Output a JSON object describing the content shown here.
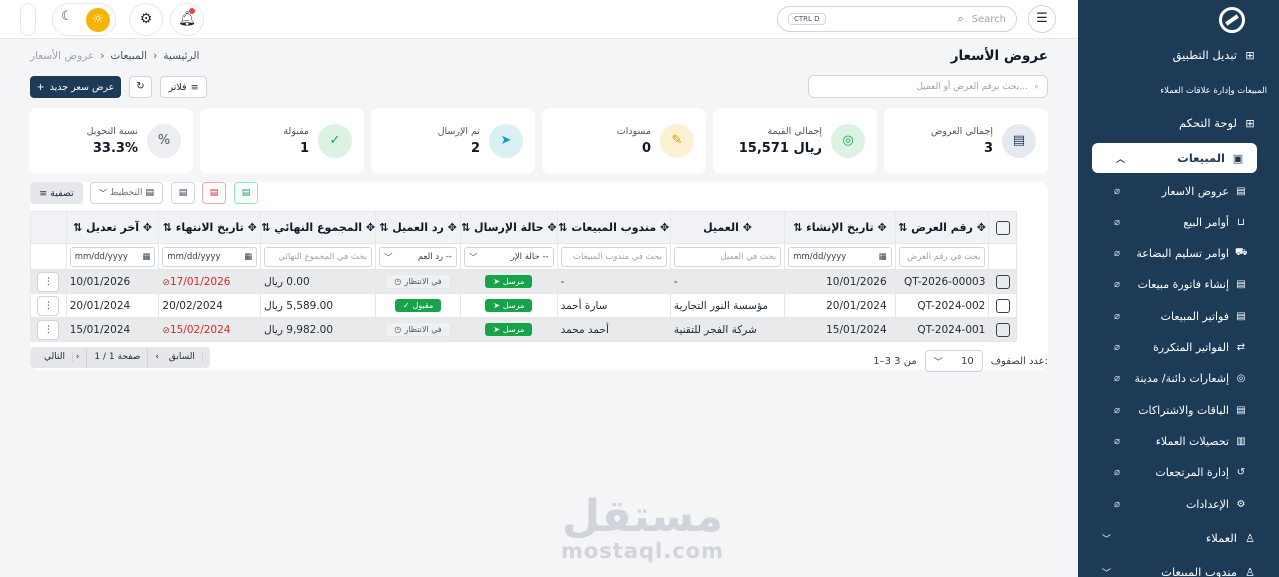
{
  "sidebar": {
    "switch_app": "تبديل التطبيق",
    "caption": "المبيعات وإدارة علاقات العملاء",
    "dashboard": "لوحة التحكم",
    "sales": "المبيعات",
    "sub_items": [
      {
        "label": "عروض الاسعار",
        "icon": "doc-icon"
      },
      {
        "label": "أوامر البيع",
        "icon": "cart-icon"
      },
      {
        "label": "اوامر تسليم البضاعة",
        "icon": "truck-icon"
      },
      {
        "label": "إنشاء فاتورة مبيعات",
        "icon": "invoice-icon"
      },
      {
        "label": "فواتير المبيعات",
        "icon": "receipt-icon"
      },
      {
        "label": "الفواتير المتكررة",
        "icon": "repeat-icon"
      },
      {
        "label": "إشعارات دائنة/ مدينة",
        "icon": "notice-icon"
      },
      {
        "label": "الباقات والاشتراكات",
        "icon": "package-icon"
      },
      {
        "label": "تحصيلات العملاء",
        "icon": "collection-icon"
      },
      {
        "label": "إدارة المرتجعات",
        "icon": "return-icon"
      },
      {
        "label": "الإعدادات",
        "icon": "settings-icon"
      }
    ],
    "customers": "العملاء",
    "sales_reps": "مندوب المبيعات"
  },
  "topbar": {
    "search_placeholder": "Search",
    "shortcut": "CTRL D"
  },
  "header": {
    "title": "عروض الأسعار",
    "breadcrumb": [
      "الرئيسية",
      "المبيعات",
      "عروض الأسعار"
    ],
    "search_placeholder": "بحث برقم العرض أو العميل...",
    "new_button": "عرض سعر جديد",
    "filters_button": "فلاتر"
  },
  "cards": [
    {
      "label": "إجمالي العروض",
      "value": "3",
      "color": "#1d3a57",
      "bg": "#e5eaf1"
    },
    {
      "label": "إجمالي القيمة",
      "value": "15,571 ريال",
      "color": "#16a34a",
      "bg": "#dcf3e4"
    },
    {
      "label": "مسودات",
      "value": "0",
      "color": "#d99a06",
      "bg": "#fbf0d2"
    },
    {
      "label": "تم الإرسال",
      "value": "2",
      "color": "#0ea5b7",
      "bg": "#daf1f4"
    },
    {
      "label": "مقبولة",
      "value": "1",
      "color": "#16a34a",
      "bg": "#dcf3e4"
    },
    {
      "label": "نسبة التحويل",
      "value": "33.3%",
      "color": "#4b5563",
      "bg": "#eceef1"
    }
  ],
  "toolbar": {
    "sort_label": "تصفية",
    "layout_label": "التخطيط"
  },
  "table": {
    "headers": [
      "رقم العرض",
      "تاريخ الإنشاء",
      "العميل",
      "مندوب المبيعات",
      "حالة الإرسال",
      "رد العميل",
      "المجموع النهائي",
      "تاريخ الانتهاء",
      "آخر تعديل"
    ],
    "filters": {
      "number": "بحث في رقم العرض",
      "date": "mm/dd/yyyy",
      "customer": "بحث في العميل",
      "rep": "بحث في مندوب المبيعات",
      "send": "-- حالة الإر",
      "reply": "-- رد العم",
      "total": "بحث في المجموع النهائي"
    },
    "rows": [
      {
        "number": "QT-2026-00003",
        "created": "10/01/2026",
        "customer": "-",
        "rep": "-",
        "send": "مرسل",
        "reply": "في الانتظار",
        "total": "0.00 ريال",
        "expiry": "17/01/2026",
        "expired": true,
        "modified": "10/01/2026"
      },
      {
        "number": "QT-2024-002",
        "created": "20/01/2024",
        "customer": "مؤسسة النور التجارية",
        "rep": "سارة أحمد",
        "send": "مرسل",
        "reply": "مقبول",
        "total": "5,589.00 ريال",
        "expiry": "20/02/2024",
        "expired": false,
        "modified": "20/01/2024"
      },
      {
        "number": "QT-2024-001",
        "created": "15/01/2024",
        "customer": "شركة الفجر للتقنية",
        "rep": "أحمد محمد",
        "send": "مرسل",
        "reply": "في الانتظار",
        "total": "9,982.00 ريال",
        "expiry": "15/02/2024",
        "expired": true,
        "modified": "15/01/2024"
      }
    ]
  },
  "footer": {
    "rows_label": "عدد الصفوف:",
    "rows_value": "10",
    "range": "1–3 من 3",
    "prev": "السابق",
    "page": "صفحة 1 / 1",
    "next": "التالي"
  },
  "watermark": {
    "arabic": "مستقل",
    "latin": "mostaql.com"
  }
}
